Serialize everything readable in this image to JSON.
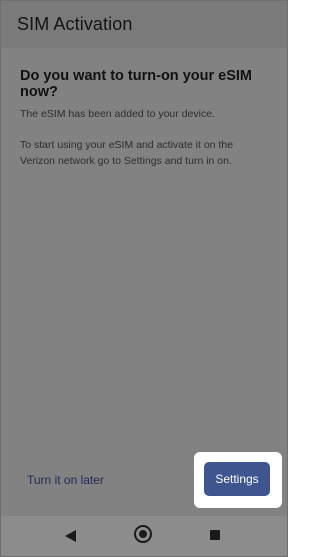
{
  "app_bar": {
    "title": "SIM Activation"
  },
  "dialog": {
    "heading": "Do you want to turn-on your eSIM now?",
    "paragraph_1": "The eSIM has been added to your device.",
    "paragraph_2": "To start using your eSIM and activate it on the Verizon network go to Settings and turn in on."
  },
  "actions": {
    "later_label": "Turn it on later",
    "settings_label": "Settings"
  },
  "nav_bar": {
    "icons": [
      "back-icon",
      "home-icon",
      "recents-icon"
    ]
  },
  "colors": {
    "overlay": "#818181",
    "primary_button": "#3e5590",
    "link_text": "#1f2a55",
    "highlight": "#ffffff"
  }
}
